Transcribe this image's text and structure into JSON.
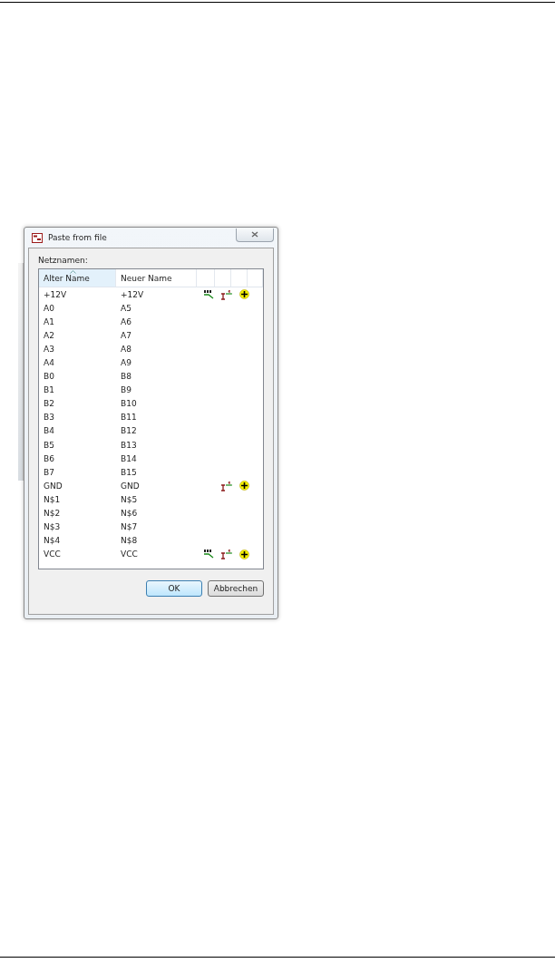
{
  "window": {
    "title": "Paste from file"
  },
  "list_label": "Netznamen:",
  "table": {
    "columns": [
      {
        "label": "Alter Name",
        "sorted": true
      },
      {
        "label": "Neuer Name",
        "sorted": false
      }
    ],
    "rows": [
      {
        "old": "+12V",
        "new": "+12V",
        "name_tag": true,
        "counter": true,
        "add": true
      },
      {
        "old": "A0",
        "new": "A5",
        "name_tag": false,
        "counter": false,
        "add": false
      },
      {
        "old": "A1",
        "new": "A6",
        "name_tag": false,
        "counter": false,
        "add": false
      },
      {
        "old": "A2",
        "new": "A7",
        "name_tag": false,
        "counter": false,
        "add": false
      },
      {
        "old": "A3",
        "new": "A8",
        "name_tag": false,
        "counter": false,
        "add": false
      },
      {
        "old": "A4",
        "new": "A9",
        "name_tag": false,
        "counter": false,
        "add": false
      },
      {
        "old": "B0",
        "new": "B8",
        "name_tag": false,
        "counter": false,
        "add": false
      },
      {
        "old": "B1",
        "new": "B9",
        "name_tag": false,
        "counter": false,
        "add": false
      },
      {
        "old": "B2",
        "new": "B10",
        "name_tag": false,
        "counter": false,
        "add": false
      },
      {
        "old": "B3",
        "new": "B11",
        "name_tag": false,
        "counter": false,
        "add": false
      },
      {
        "old": "B4",
        "new": "B12",
        "name_tag": false,
        "counter": false,
        "add": false
      },
      {
        "old": "B5",
        "new": "B13",
        "name_tag": false,
        "counter": false,
        "add": false
      },
      {
        "old": "B6",
        "new": "B14",
        "name_tag": false,
        "counter": false,
        "add": false
      },
      {
        "old": "B7",
        "new": "B15",
        "name_tag": false,
        "counter": false,
        "add": false
      },
      {
        "old": "GND",
        "new": "GND",
        "name_tag": false,
        "counter": true,
        "add": true
      },
      {
        "old": "N$1",
        "new": "N$5",
        "name_tag": false,
        "counter": false,
        "add": false
      },
      {
        "old": "N$2",
        "new": "N$6",
        "name_tag": false,
        "counter": false,
        "add": false
      },
      {
        "old": "N$3",
        "new": "N$7",
        "name_tag": false,
        "counter": false,
        "add": false
      },
      {
        "old": "N$4",
        "new": "N$8",
        "name_tag": false,
        "counter": false,
        "add": false
      },
      {
        "old": "VCC",
        "new": "VCC",
        "name_tag": true,
        "counter": true,
        "add": true
      }
    ]
  },
  "buttons": [
    {
      "label": "OK",
      "default": true
    },
    {
      "label": "Abbrechen",
      "default": false
    }
  ]
}
